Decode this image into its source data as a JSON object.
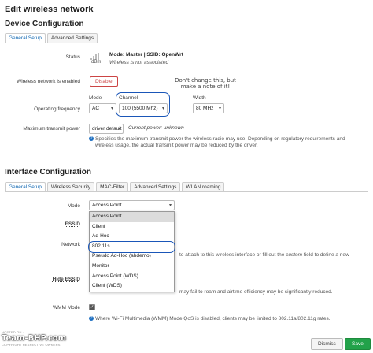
{
  "page_title": "Edit wireless network",
  "device": {
    "section_title": "Device Configuration",
    "tabs": [
      {
        "label": "General Setup",
        "active": true
      },
      {
        "label": "Advanced Settings",
        "active": false
      }
    ],
    "status": {
      "label": "Status",
      "line1": "Mode: Master | SSID: OpenWrt",
      "dbm": "dBm",
      "line2": "Wireless is not associated"
    },
    "enabled": {
      "label": "Wireless network is enabled",
      "button": "Disable"
    },
    "annotation": "Don't change this, but\nmake a note of it!",
    "frequency": {
      "label": "Operating frequency",
      "mode_head": "Mode",
      "mode_value": "AC",
      "channel_head": "Channel",
      "channel_value": "100 (5500 Mhz)",
      "width_head": "Width",
      "width_value": "80 MHz"
    },
    "power": {
      "label": "Maximum transmit power",
      "value": "driver default",
      "current": "- Current power: unknown",
      "help1": "Specifies the maximum transmit power the wireless radio may use. Depending on regulatory requirements and",
      "help2": "wireless usage, the actual transmit power may be reduced by the driver."
    }
  },
  "interface": {
    "section_title": "Interface Configuration",
    "tabs": [
      {
        "label": "General Setup",
        "active": true
      },
      {
        "label": "Wireless Security",
        "active": false
      },
      {
        "label": "MAC-Filter",
        "active": false
      },
      {
        "label": "Advanced Settings",
        "active": false
      },
      {
        "label": "WLAN roaming",
        "active": false
      }
    ],
    "mode": {
      "label": "Mode",
      "value": "Access Point",
      "options": [
        "Access Point",
        "Client",
        "Ad-Hoc",
        "802.11s",
        "Pseudo Ad-Hoc (ahdemo)",
        "Monitor",
        "Access Point (WDS)",
        "Client (WDS)"
      ],
      "highlighted": "Access Point",
      "circled": "802.11s"
    },
    "essid_label": "ESSID",
    "network": {
      "label": "Network",
      "help_partial": "to attach to this wireless interface or fill out the",
      "help_custom": "custom",
      "help_end": "field to define a new"
    },
    "hide_essid": {
      "label": "Hide ESSID",
      "help_partial": "may fail to roam and airtime efficiency may be significantly reduced."
    },
    "wmm": {
      "label": "WMM Mode",
      "checked": true,
      "help": "Where Wi-Fi Multimedia (WMM) Mode QoS is disabled, clients may be limited to 802.11a/802.11g rates."
    }
  },
  "footer": {
    "dismiss": "Dismiss",
    "save": "Save"
  },
  "watermark": {
    "top": "HOSTED ON :",
    "main": "Team-BHP.com",
    "bottom": "COPYRIGHT RESPECTIVE OWNERS"
  },
  "colors": {
    "accent": "#0a63b0",
    "annotation_circle": "#1a56b8",
    "disable": "#cc4444",
    "save": "#22a24a"
  }
}
